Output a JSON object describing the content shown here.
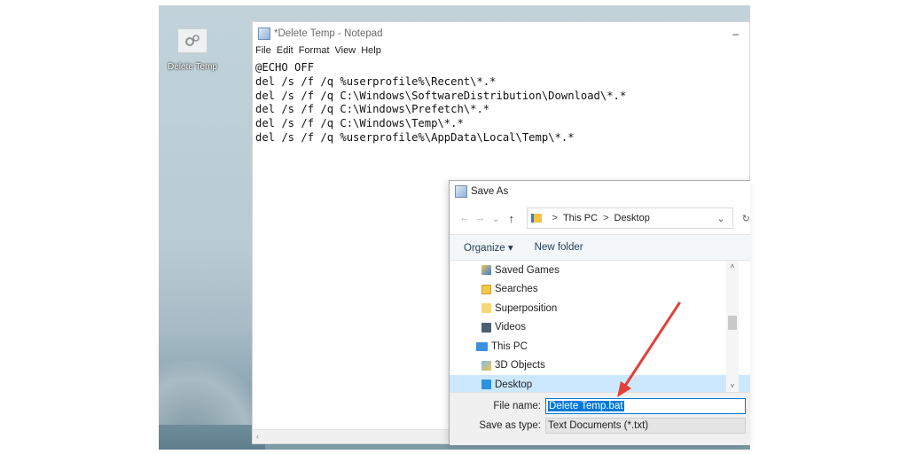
{
  "desktop": {
    "icon_label": "Delete Temp",
    "icon_name": "gear-file-icon"
  },
  "notepad": {
    "title": "*Delete Temp - Notepad",
    "minimize_glyph": "–",
    "menu": [
      "File",
      "Edit",
      "Format",
      "View",
      "Help"
    ],
    "lines": [
      "@ECHO OFF",
      "del /s /f /q %userprofile%\\Recent\\*.*",
      "del /s /f /q C:\\Windows\\SoftwareDistribution\\Download\\*.*",
      "del /s /f /q C:\\Windows\\Prefetch\\*.*",
      "del /s /f /q C:\\Windows\\Temp\\*.*",
      "del /s /f /q %userprofile%\\AppData\\Local\\Temp\\*.*"
    ],
    "hscroll_glyph": "‹"
  },
  "save_as": {
    "title": "Save As",
    "nav": {
      "back": "←",
      "forward": "→",
      "recent": "⌄",
      "up": "↑",
      "refresh": "↻"
    },
    "address": {
      "root": "This PC",
      "separator": ">",
      "current": "Desktop",
      "dropdown": "⌄"
    },
    "toolbar": {
      "organize": "Organize ▾",
      "new_folder": "New folder"
    },
    "tree": [
      {
        "label": "Saved Games",
        "level": 1,
        "icon": "saved-games-icon"
      },
      {
        "label": "Searches",
        "level": 1,
        "icon": "searches-icon"
      },
      {
        "label": "Superposition",
        "level": 1,
        "icon": "folder-icon"
      },
      {
        "label": "Videos",
        "level": 1,
        "icon": "videos-icon"
      },
      {
        "label": "This PC",
        "level": 0,
        "icon": "this-pc-icon"
      },
      {
        "label": "3D Objects",
        "level": 1,
        "icon": "3d-objects-icon"
      },
      {
        "label": "Desktop",
        "level": 1,
        "icon": "desktop-folder-icon",
        "selected": true
      }
    ],
    "scroll": {
      "up": "˄",
      "down": "˅"
    },
    "file_name_label": "File name:",
    "file_name_value": "Delete Temp.bat",
    "save_type_label": "Save as type:",
    "save_type_value": "Text Documents (*.txt)"
  },
  "colors": {
    "selection": "#0078d7",
    "tree_selected": "#cce8ff",
    "arrow": "#e2403a"
  }
}
